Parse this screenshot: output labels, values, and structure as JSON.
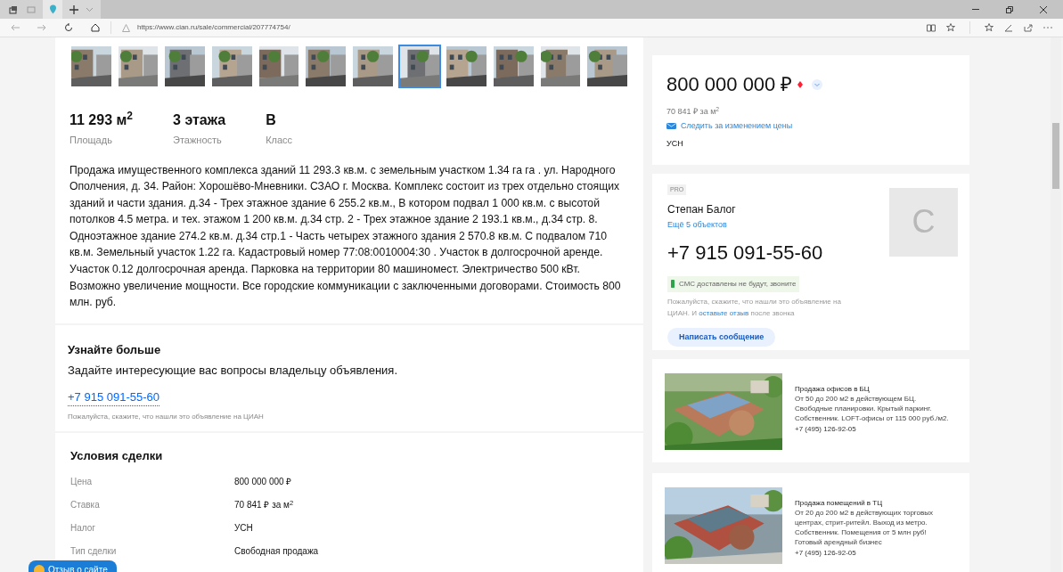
{
  "browser": {
    "url": "https://www.cian.ru/sale/commercial/207774754/"
  },
  "gallery": {
    "thumbnails": [
      {
        "selected": false
      },
      {
        "selected": false
      },
      {
        "selected": false
      },
      {
        "selected": false
      },
      {
        "selected": false
      },
      {
        "selected": false
      },
      {
        "selected": false
      },
      {
        "selected": true
      },
      {
        "selected": false
      },
      {
        "selected": false
      },
      {
        "selected": false
      },
      {
        "selected": false
      }
    ]
  },
  "stats": [
    {
      "value": "11 293 м$^{2}$",
      "label": "Площадь"
    },
    {
      "value": "3 этажа",
      "label": "Этажность"
    },
    {
      "value": "B",
      "label": "Класс"
    }
  ],
  "description": "Продажа имущественного комплекса зданий 11 293.3 кв.м. с земельным участком 1.34 га га . ул. Народного Ополчения, д. 34. Район: Хорошёво-Мневники. СЗАО г. Москва. Комплекс состоит из трех отдельно стоящих зданий и части здания. д.34 - Трех этажное здание 6 255.2 кв.м., В котором подвал 1 000 кв.м. с высотой потолков 4.5 метра. и тех. этажом 1 200 кв.м. д.34 стр. 2 - Трех этажное здание 2 193.1 кв.м., д.34 стр. 8. Одноэтажное здание 274.2 кв.м. д.34 стр.1 - Часть четырех этажного здания 2 570.8 кв.м. С подвалом 710 кв.м. Земельный участок 1.22 га. Кадастровый номер 77:08:0010004:30 . Участок в долгосрочной аренде. Участок 0.12 долгосрочная аренда. Парковка на территории 80 машиномест. Электричество 500 кВт. Возможно увеличение мощности. Все городские коммуникации с заключенными договорами. Стоимость 800 млн. руб.",
  "contact_section": {
    "title": "Узнайте больше",
    "subtitle": "Задайте интересующие вас вопросы владельцу объявления.",
    "phone": "+7 915 091-55-60",
    "note": "Пожалуйста, скажите, что нашли это объявление на ЦИАН"
  },
  "deal_terms": {
    "title": "Условия сделки",
    "rows": [
      {
        "label": "Цена",
        "value": "800 000 000 ₽"
      },
      {
        "label": "Ставка",
        "value": "70 841 ₽ за м$^{2}$"
      },
      {
        "label": "Налог",
        "value": "УСН"
      },
      {
        "label": "Тип сделки",
        "value": "Свободная продажа"
      }
    ]
  },
  "feedback_button": "Отзыв о сайте",
  "price_card": {
    "price": "800 000 000 ₽",
    "per_m2": "70 841 ₽ за м$^{2}$",
    "follow_link": "Следить за изменением цены",
    "tax": "УСН"
  },
  "agent": {
    "badge": "PRO",
    "name": "Степан Балог",
    "more_link": "Ещё 5 объектов",
    "avatar_letter": "С",
    "phone": "+7 915 091-55-60",
    "sms_note": "СМС доставлены не будут, звоните",
    "note_before": "Пожалуйста, скажите, что нашли это объявление на ЦИАН. И",
    "note_link": "оставьте отзыв",
    "note_after": "после звонка",
    "message_button": "Написать сообщение"
  },
  "ads": [
    {
      "title": "Продажа офисов в БЦ",
      "text": "От 50 до 200 м2 в действующем БЦ. Свободные планировки. Крытый паркинг. Собственник. LOFT-офисы от 115 000 руб./м2.",
      "phone": "+7 (495) 126-92-05"
    },
    {
      "title": "Продажа помещений в ТЦ",
      "text": "От 20 до 200 м2 в действующих торговых центрах, стрит-ритейл. Выход из метро. Собственник. Помещения от 5 млн руб! Готовый арендный бизнес",
      "phone": "+7 (495) 126-92-05"
    }
  ]
}
